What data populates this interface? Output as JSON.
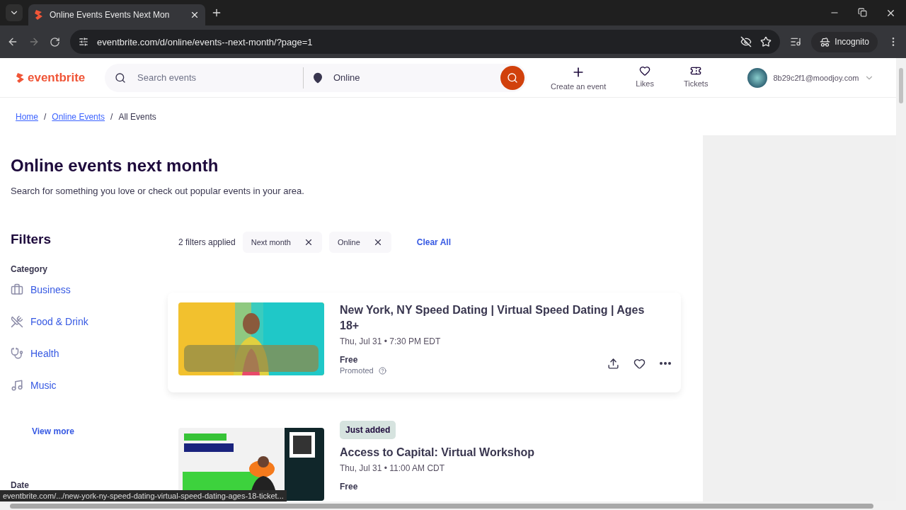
{
  "browser": {
    "tab_title": "Online Events Events Next Mon",
    "url": "eventbrite.com/d/online/events--next-month/?page=1",
    "profile_label": "Incognito",
    "status_url": "eventbrite.com/.../new-york-ny-speed-dating-virtual-speed-dating-ages-18-ticket..."
  },
  "header": {
    "logo": "eventbrite",
    "search_placeholder": "Search events",
    "location": "Online",
    "nav": [
      {
        "label": "Create an event",
        "kind": "plus"
      },
      {
        "label": "Likes",
        "kind": "heart"
      },
      {
        "label": "Tickets",
        "kind": "ticket"
      }
    ],
    "account": "8b29c2f1@moodjoy.com"
  },
  "breadcrumbs": [
    {
      "label": "Home",
      "link": true,
      "separator": "/"
    },
    {
      "label": "Online Events",
      "link": true,
      "separator": "/"
    },
    {
      "label": "All Events",
      "link": false
    }
  ],
  "page_title": "Online events next month",
  "subtitle": "Search for something you love or check out popular events in your area.",
  "filters": {
    "title": "Filters",
    "category_heading": "Category",
    "categories": [
      {
        "label": "Business",
        "kind": "business"
      },
      {
        "label": "Food & Drink",
        "kind": "food"
      },
      {
        "label": "Health",
        "kind": "health"
      },
      {
        "label": "Music",
        "kind": "music"
      }
    ],
    "view_more": "View more",
    "date_heading": "Date"
  },
  "applied": {
    "count_label": "2 filters applied",
    "chips": [
      "Next month",
      "Online"
    ],
    "clear": "Clear All"
  },
  "events": [
    {
      "title": "New York, NY Speed Dating | Virtual Speed Dating | Ages 18+",
      "date": "Thu, Jul 31 • 7:30 PM EDT",
      "price": "Free",
      "promoted": "Promoted"
    },
    {
      "badge": "Just added",
      "title": "Access to Capital: Virtual Workshop",
      "date": "Thu, Jul 31 • 11:00 AM CDT",
      "price": "Free"
    }
  ]
}
